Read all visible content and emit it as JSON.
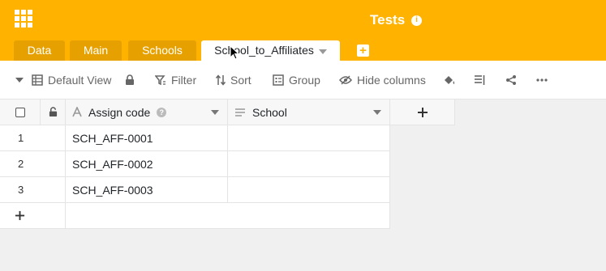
{
  "app": {
    "title": "Tests"
  },
  "tabs": [
    {
      "label": "Data"
    },
    {
      "label": "Main"
    },
    {
      "label": "Schools"
    },
    {
      "label": "School_to_Affiliates"
    }
  ],
  "toolbar": {
    "view_label": "Default View",
    "filter_label": "Filter",
    "sort_label": "Sort",
    "group_label": "Group",
    "hide_columns_label": "Hide columns"
  },
  "columns": [
    {
      "name": "Assign code",
      "type_icon": "text-type-icon"
    },
    {
      "name": "School",
      "type_icon": "long-text-type-icon"
    }
  ],
  "rows": [
    {
      "index": "1",
      "assign_code": "SCH_AFF-0001",
      "school": ""
    },
    {
      "index": "2",
      "assign_code": "SCH_AFF-0002",
      "school": ""
    },
    {
      "index": "3",
      "assign_code": "SCH_AFF-0003",
      "school": ""
    }
  ],
  "colors": {
    "header": "#ffb300",
    "inactive_tab": "#e6a100"
  }
}
